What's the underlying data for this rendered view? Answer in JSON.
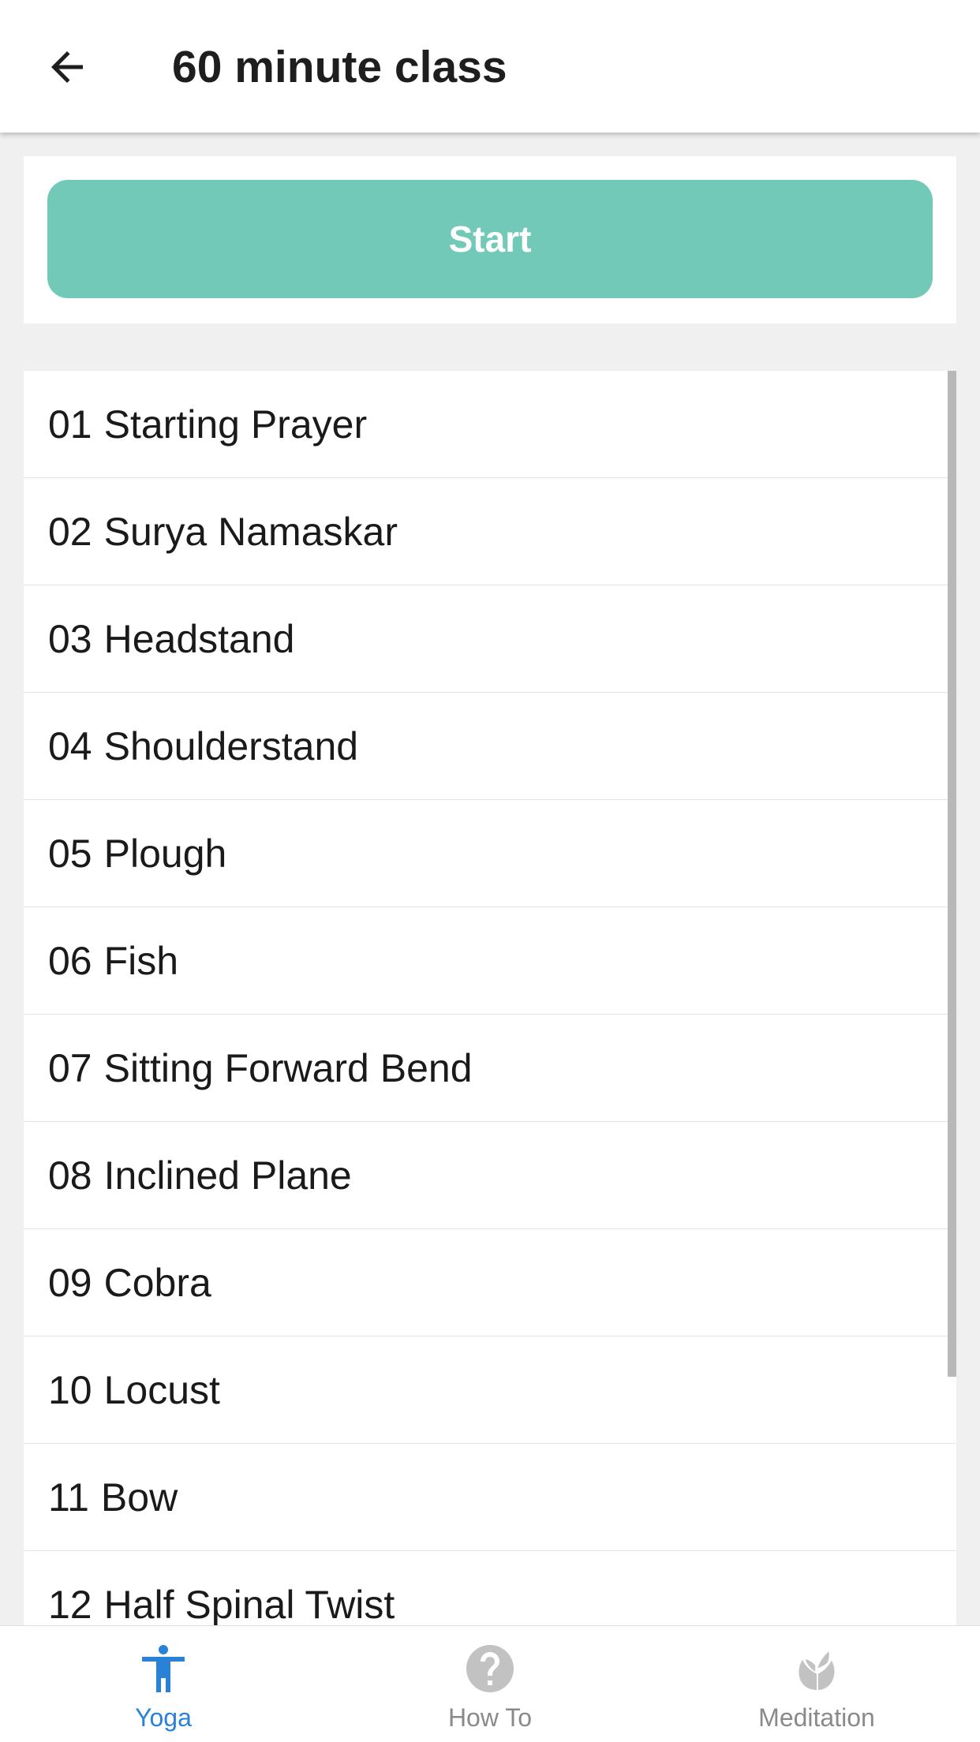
{
  "header": {
    "title": "60 minute class",
    "back_icon": "arrow-left-icon"
  },
  "start": {
    "label": "Start",
    "color": "#72c9b8"
  },
  "poses": [
    {
      "num": "01",
      "name": "Starting Prayer"
    },
    {
      "num": "02",
      "name": "Surya Namaskar"
    },
    {
      "num": "03",
      "name": "Headstand"
    },
    {
      "num": "04",
      "name": "Shoulderstand"
    },
    {
      "num": "05",
      "name": "Plough"
    },
    {
      "num": "06",
      "name": "Fish"
    },
    {
      "num": "07",
      "name": "Sitting Forward Bend"
    },
    {
      "num": "08",
      "name": "Inclined Plane"
    },
    {
      "num": "09",
      "name": "Cobra"
    },
    {
      "num": "10",
      "name": "Locust"
    },
    {
      "num": "11",
      "name": "Bow"
    },
    {
      "num": "12",
      "name": "Half Spinal Twist"
    }
  ],
  "bottom_nav": {
    "active": "yoga",
    "active_color": "#2a82d6",
    "items": [
      {
        "id": "yoga",
        "label": "Yoga",
        "icon": "person-icon"
      },
      {
        "id": "howto",
        "label": "How To",
        "icon": "question-circle-icon"
      },
      {
        "id": "meditation",
        "label": "Meditation",
        "icon": "lotus-icon"
      }
    ]
  }
}
